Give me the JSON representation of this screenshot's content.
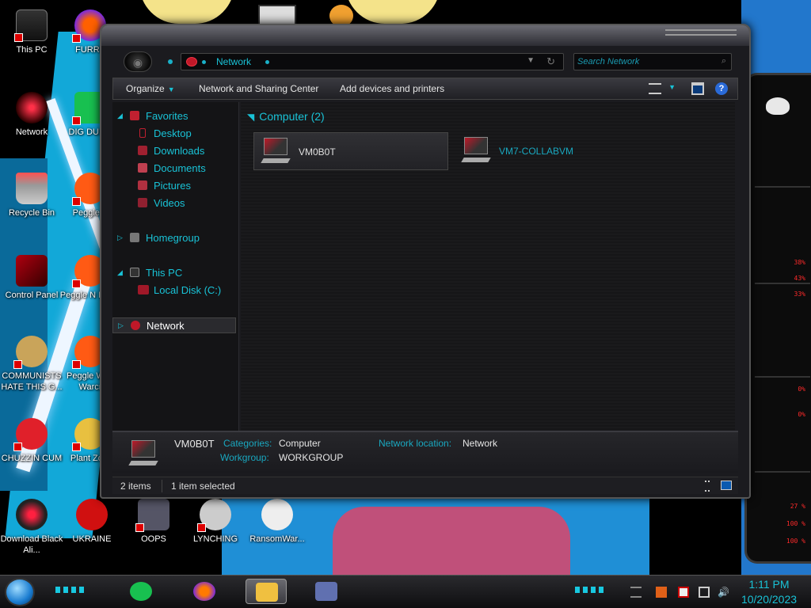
{
  "desktop": {
    "icons_left": [
      {
        "label": "This PC"
      },
      {
        "label": "Network"
      },
      {
        "label": "Recycle Bin"
      },
      {
        "label": "Control Panel"
      },
      {
        "label": "COMMUNISTS HATE THIS G..."
      },
      {
        "label": "CHUZZIN CUM"
      },
      {
        "label": "Download Black Ali..."
      }
    ],
    "icons_col2": [
      {
        "label": "FURRY"
      },
      {
        "label": "DIG DUMB"
      },
      {
        "label": "Peggle B"
      },
      {
        "label": "Peggle N Delux"
      },
      {
        "label": "Peggle W of Warcr"
      },
      {
        "label": "Plant Zom"
      }
    ],
    "icons_bottom": [
      {
        "label": "UKRAINE"
      },
      {
        "label": "OOPS"
      },
      {
        "label": "LYNCHING"
      },
      {
        "label": "RansomWar..."
      }
    ]
  },
  "gadget": {
    "values": [
      "38%",
      "43%",
      "33%",
      "0%",
      "0%",
      "27 %",
      "100 %",
      "100 %"
    ]
  },
  "window": {
    "address": {
      "crumb": "Network"
    },
    "search": {
      "placeholder": "Search Network"
    },
    "toolbar": {
      "organize": "Organize",
      "network_sharing": "Network and Sharing Center",
      "add_devices": "Add devices and printers"
    },
    "nav": {
      "favorites": "Favorites",
      "desktop": "Desktop",
      "downloads": "Downloads",
      "documents": "Documents",
      "pictures": "Pictures",
      "videos": "Videos",
      "homegroup": "Homegroup",
      "this_pc": "This PC",
      "local_disk": "Local Disk (C:)",
      "network": "Network"
    },
    "content": {
      "group_header": "Computer (2)",
      "items": [
        {
          "name": "VM0B0T"
        },
        {
          "name": "VM7-COLLABVM"
        }
      ]
    },
    "details": {
      "name": "VM0B0T",
      "categories_label": "Categories:",
      "categories_value": "Computer",
      "workgroup_label": "Workgroup:",
      "workgroup_value": "WORKGROUP",
      "netloc_label": "Network location:",
      "netloc_value": "Network"
    },
    "status": {
      "items": "2 items",
      "selected": "1 item selected"
    }
  },
  "taskbar": {
    "time": "1:11 PM",
    "date": "10/20/2023"
  },
  "colors": {
    "accent": "#19c2d6",
    "window_bg": "#1b1b1f",
    "alert_red": "#ff2a2a"
  }
}
